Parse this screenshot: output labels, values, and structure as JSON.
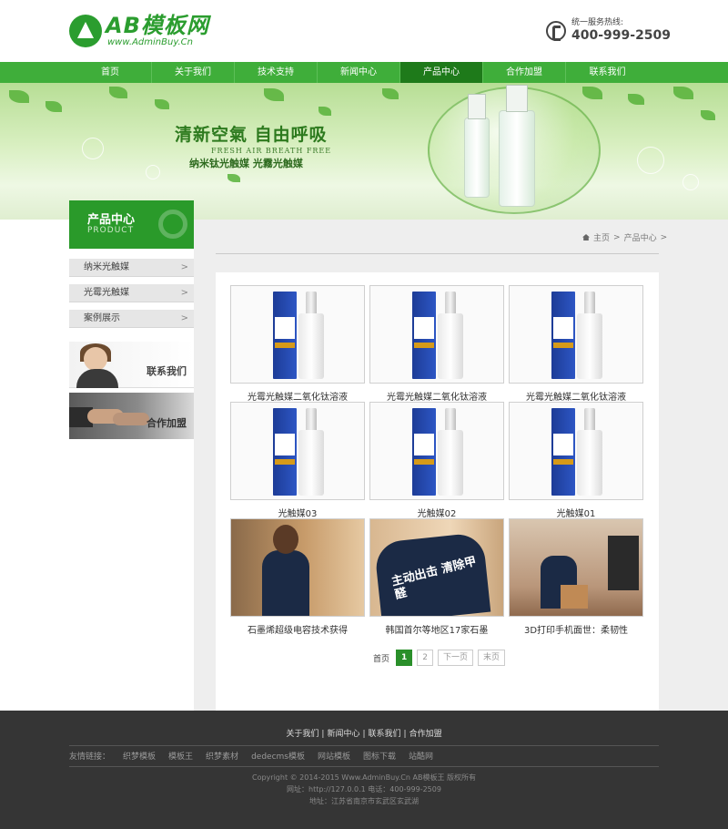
{
  "header": {
    "logo_title": "AB模板网",
    "logo_sub": "www.AdminBuy.Cn",
    "hotline_label": "统一服务热线:",
    "hotline_number": "400-999-2509"
  },
  "nav": {
    "items": [
      "首页",
      "关于我们",
      "技术支持",
      "新闻中心",
      "产品中心",
      "合作加盟",
      "联系我们"
    ],
    "active": "产品中心"
  },
  "banner": {
    "headline": "清新空氣 自由呼吸",
    "english": "FRESH AIR BREATH FREE",
    "sub": "纳米钛光触媒 光霧光触媒"
  },
  "sidebar": {
    "title": "产品中心",
    "subtitle": "PRODUCT",
    "items": [
      "纳米光触媒",
      "光霉光触媒",
      "案例展示"
    ],
    "promo_contact": "联系我们",
    "promo_join": "合作加盟",
    "arrow": ">"
  },
  "breadcrumb": {
    "home": "主页",
    "sep": ">",
    "current": "产品中心"
  },
  "products": [
    "光霉光触媒二氧化钛溶液",
    "光霉光触媒二氧化钛溶液",
    "光霉光触媒二氧化钛溶液",
    "光触媒03",
    "光触媒02",
    "光触媒01",
    "石墨烯超级电容技术获得",
    "韩国首尔等地区17家石墨",
    "3D打印手机面世：柔韧性"
  ],
  "photo_texts": {
    "jacket1": "主动出击 清除甲醛",
    "jacket2": "主动出击 清除甲醛"
  },
  "pager": {
    "first": "首页",
    "current": "1",
    "page2": "2",
    "next": "下一页",
    "last": "末页"
  },
  "footer": {
    "links": [
      "关于我们",
      "新闻中心",
      "联系我们",
      "合作加盟"
    ],
    "friend_label": "友情链接：",
    "friends": [
      "织梦模板",
      "模板王",
      "织梦素材",
      "dedecms模板",
      "网站模板",
      "图标下载",
      "站酷网"
    ],
    "copyright": "Copyright © 2014-2015 Www.AdminBuy.Cn AB模板王 版权所有",
    "contact": "网址：http://127.0.0.1 电话：400-999-2509",
    "address": "地址：江苏省南京市玄武区玄武湖"
  },
  "colors": {
    "brand_green": "#2b9d2f",
    "nav_green": "#3fae3a",
    "nav_active": "#1e7a1a",
    "footer_bg": "#353535"
  }
}
